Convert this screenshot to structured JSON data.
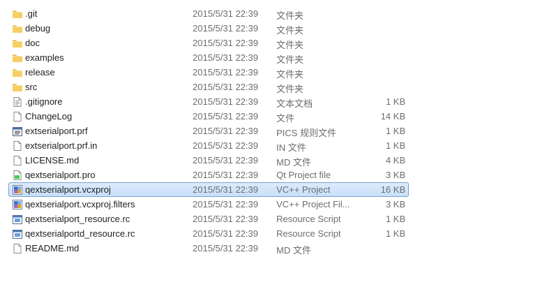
{
  "files": [
    {
      "name": ".git",
      "date": "2015/5/31 22:39",
      "type": "文件夹",
      "size": "",
      "icon": "folder-icon",
      "selected": false
    },
    {
      "name": "debug",
      "date": "2015/5/31 22:39",
      "type": "文件夹",
      "size": "",
      "icon": "folder-icon",
      "selected": false
    },
    {
      "name": "doc",
      "date": "2015/5/31 22:39",
      "type": "文件夹",
      "size": "",
      "icon": "folder-icon",
      "selected": false
    },
    {
      "name": "examples",
      "date": "2015/5/31 22:39",
      "type": "文件夹",
      "size": "",
      "icon": "folder-icon",
      "selected": false
    },
    {
      "name": "release",
      "date": "2015/5/31 22:39",
      "type": "文件夹",
      "size": "",
      "icon": "folder-icon",
      "selected": false
    },
    {
      "name": "src",
      "date": "2015/5/31 22:39",
      "type": "文件夹",
      "size": "",
      "icon": "folder-icon",
      "selected": false
    },
    {
      "name": ".gitignore",
      "date": "2015/5/31 22:39",
      "type": "文本文档",
      "size": "1 KB",
      "icon": "text-document-icon",
      "selected": false
    },
    {
      "name": "ChangeLog",
      "date": "2015/5/31 22:39",
      "type": "文件",
      "size": "14 KB",
      "icon": "file-icon",
      "selected": false
    },
    {
      "name": "extserialport.prf",
      "date": "2015/5/31 22:39",
      "type": "PICS 规则文件",
      "size": "1 KB",
      "icon": "pics-rules-file-icon",
      "selected": false
    },
    {
      "name": "extserialport.prf.in",
      "date": "2015/5/31 22:39",
      "type": "IN 文件",
      "size": "1 KB",
      "icon": "file-icon",
      "selected": false
    },
    {
      "name": "LICENSE.md",
      "date": "2015/5/31 22:39",
      "type": "MD 文件",
      "size": "4 KB",
      "icon": "file-icon",
      "selected": false
    },
    {
      "name": "qextserialport.pro",
      "date": "2015/5/31 22:39",
      "type": "Qt Project file",
      "size": "3 KB",
      "icon": "qt-project-icon",
      "selected": false
    },
    {
      "name": "qextserialport.vcxproj",
      "date": "2015/5/31 22:39",
      "type": "VC++ Project",
      "size": "16 KB",
      "icon": "vc-project-icon",
      "selected": true
    },
    {
      "name": "qextserialport.vcxproj.filters",
      "date": "2015/5/31 22:39",
      "type": "VC++ Project Fil...",
      "size": "3 KB",
      "icon": "vc-project-icon",
      "selected": false
    },
    {
      "name": "qextserialport_resource.rc",
      "date": "2015/5/31 22:39",
      "type": "Resource Script",
      "size": "1 KB",
      "icon": "resource-script-icon",
      "selected": false
    },
    {
      "name": "qextserialportd_resource.rc",
      "date": "2015/5/31 22:39",
      "type": "Resource Script",
      "size": "1 KB",
      "icon": "resource-script-icon",
      "selected": false
    },
    {
      "name": "README.md",
      "date": "2015/5/31 22:39",
      "type": "MD 文件",
      "size": "",
      "icon": "file-icon",
      "selected": false
    }
  ]
}
